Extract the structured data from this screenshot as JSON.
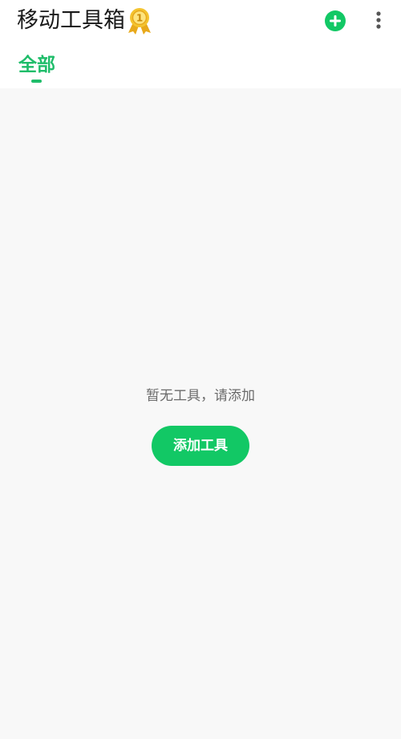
{
  "app": {
    "title": "移动工具箱"
  },
  "header_icons": {
    "badge": "medal-icon",
    "add": "add-circle-icon",
    "more": "more-vertical-icon"
  },
  "tabs": [
    {
      "label": "全部",
      "selected": true
    }
  ],
  "empty_state": {
    "message": "暂无工具，请添加",
    "button_label": "添加工具"
  },
  "colors": {
    "accent": "#12c865",
    "tab_active": "#1fbd6a",
    "medal": "#f4c430",
    "background": "#f8f8f8"
  }
}
